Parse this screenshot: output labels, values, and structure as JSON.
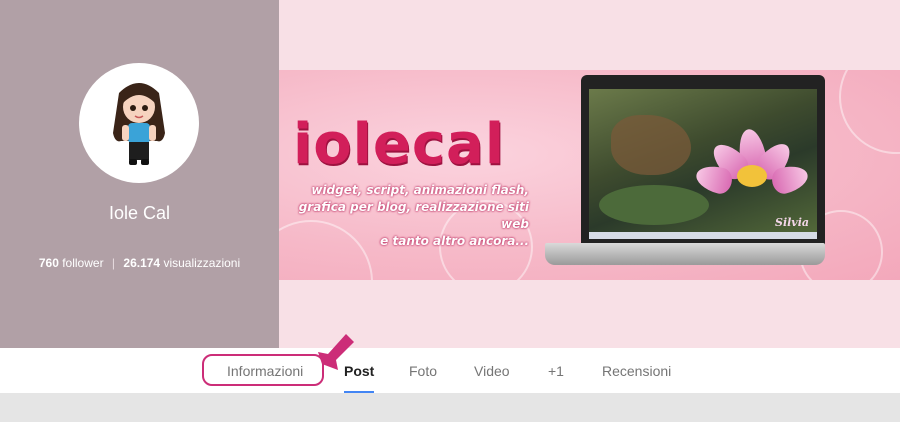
{
  "profile": {
    "name": "Iole Cal",
    "followers_count": "760",
    "followers_label": "follower",
    "separator": "|",
    "views_count": "26.174",
    "views_label": "visualizzazioni"
  },
  "banner": {
    "brand": "iolecal",
    "tagline_lines": [
      "widget, script, animazioni flash,",
      "grafica per blog, realizzazione siti web",
      "e tanto altro ancora..."
    ],
    "screen_signature": "Silvia"
  },
  "tabs": [
    {
      "label": "Informazioni",
      "active": false
    },
    {
      "label": "Post",
      "active": true
    },
    {
      "label": "Foto",
      "active": false
    },
    {
      "label": "Video",
      "active": false
    },
    {
      "label": "+1",
      "active": false
    },
    {
      "label": "Recensioni",
      "active": false
    }
  ],
  "colors": {
    "accent_underline": "#4285f4",
    "highlight": "#cc2d78",
    "brand": "#d21f5a"
  },
  "icons": {
    "annotation": "pointer-arrow-icon",
    "avatar": "avatar-doll-illustration"
  }
}
